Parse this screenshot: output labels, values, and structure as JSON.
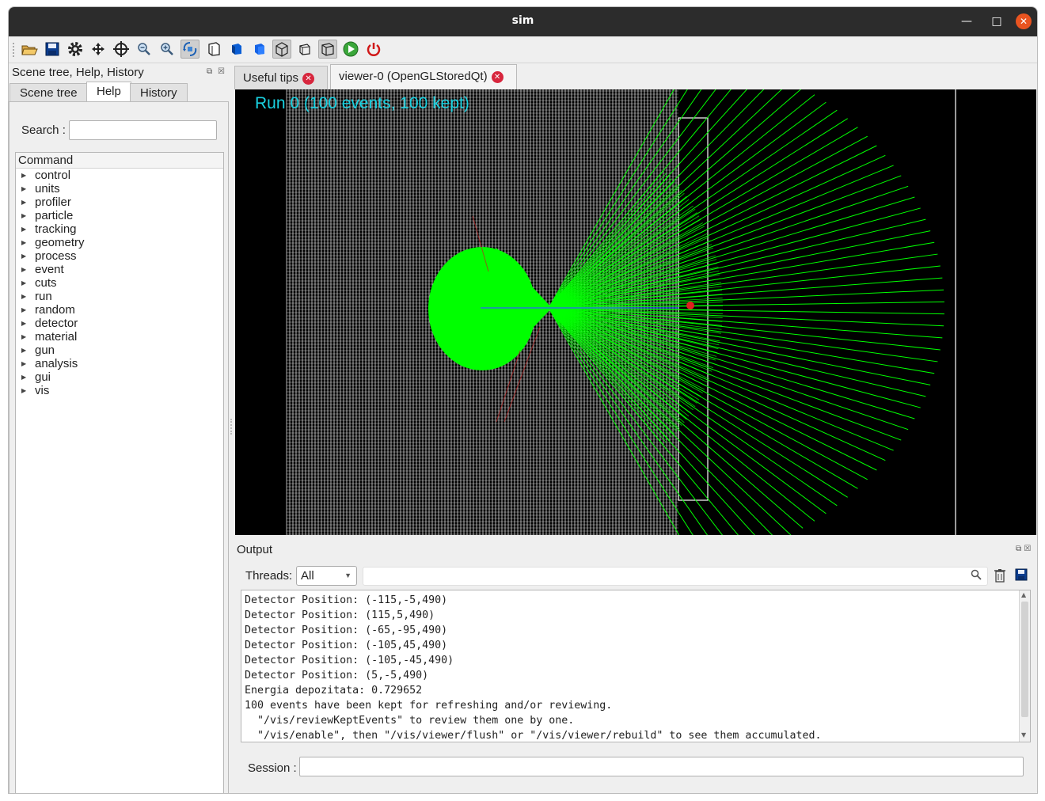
{
  "window": {
    "title": "sim"
  },
  "toolbar": {
    "icons": [
      "open-icon",
      "save-icon",
      "settings-icon",
      "move-icon",
      "pick-icon",
      "zoom-out-icon",
      "zoom-in-icon",
      "rotate-icon",
      "hidden-line-icon",
      "solid-icon",
      "surface-icon",
      "perspective-icon",
      "wireframe-icon",
      "ortho-icon",
      "run-icon",
      "exit-icon"
    ]
  },
  "left_dock": {
    "title": "Scene tree, Help, History",
    "tabs": [
      "Scene tree",
      "Help",
      "History"
    ],
    "active_tab": "Help",
    "search_label": "Search :",
    "search_value": "",
    "tree_header": "Command",
    "commands": [
      "control",
      "units",
      "profiler",
      "particle",
      "tracking",
      "geometry",
      "process",
      "event",
      "cuts",
      "run",
      "random",
      "detector",
      "material",
      "gun",
      "analysis",
      "gui",
      "vis"
    ]
  },
  "viewer_tabs": [
    {
      "label": "Useful tips"
    },
    {
      "label": "viewer-0 (OpenGLStoredQt)"
    }
  ],
  "viewer": {
    "overlay_text": "Run 0 (100 events, 100 kept)",
    "track_color": "#00ff00",
    "label_color": "#19d1e0"
  },
  "output": {
    "title": "Output",
    "threads_label": "Threads:",
    "threads_value": "All",
    "filter_value": "",
    "lines": [
      "Detector Position: (-115,-5,490)",
      "Detector Position: (115,5,490)",
      "Detector Position: (-65,-95,490)",
      "Detector Position: (-105,45,490)",
      "Detector Position: (-105,-45,490)",
      "Detector Position: (5,-5,490)",
      "Energia depozitata: 0.729652",
      "100 events have been kept for refreshing and/or reviewing.",
      "  \"/vis/reviewKeptEvents\" to review them one by one.",
      "  \"/vis/enable\", then \"/vis/viewer/flush\" or \"/vis/viewer/rebuild\" to see them accumulated."
    ],
    "session_label": "Session :",
    "session_value": ""
  }
}
